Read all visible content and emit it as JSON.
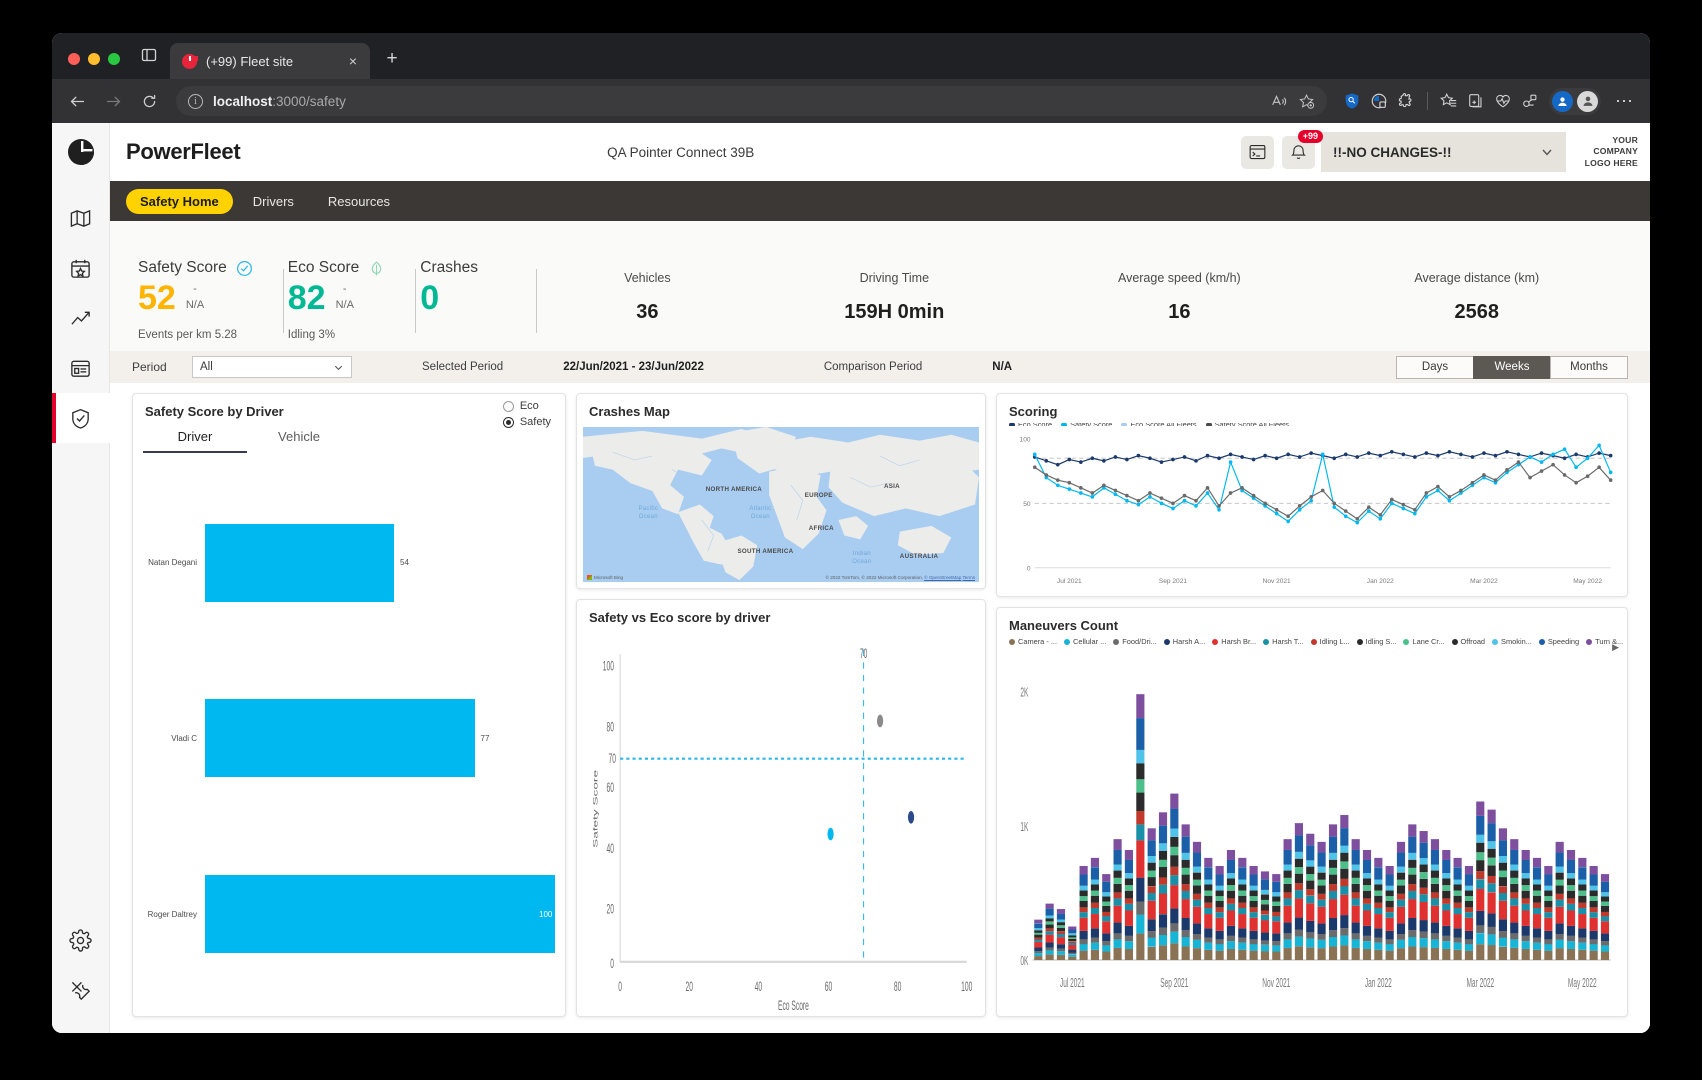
{
  "browser": {
    "tab_title": "(+99) Fleet site",
    "tab_close": "×",
    "new_tab": "+",
    "url_bold": "localhost",
    "url_rest": ":3000/safety"
  },
  "header": {
    "brand": "PowerFleet",
    "site_name": "QA Pointer Connect 39B",
    "notifications_badge": "+99",
    "fleet_selected": "!!-NO CHANGES-!!",
    "company_logo": "YOUR COMPANY LOGO HERE"
  },
  "nav": {
    "tabs": [
      {
        "label": "Safety Home",
        "active": true
      },
      {
        "label": "Drivers",
        "active": false
      },
      {
        "label": "Resources",
        "active": false
      }
    ]
  },
  "kpis": {
    "safety": {
      "title": "Safety Score",
      "value": "52",
      "delta": "-",
      "delta_sub": "N/A",
      "sub": "Events per km 5.28"
    },
    "eco": {
      "title": "Eco Score",
      "value": "82",
      "delta": "-",
      "delta_sub": "N/A",
      "sub": "Idling 3%"
    },
    "crashes": {
      "title": "Crashes",
      "value": "0"
    },
    "stats": [
      {
        "label": "Vehicles",
        "value": "36"
      },
      {
        "label": "Driving Time",
        "value": "159H 0min"
      },
      {
        "label": "Average speed (km/h)",
        "value": "16"
      },
      {
        "label": "Average distance (km)",
        "value": "2568"
      }
    ]
  },
  "period_bar": {
    "period_label": "Period",
    "period_value": "All",
    "selected_period_label": "Selected Period",
    "selected_period_value": "22/Jun/2021 - 23/Jun/2022",
    "comparison_label": "Comparison Period",
    "comparison_value": "N/A",
    "granularity": [
      {
        "label": "Days",
        "active": false
      },
      {
        "label": "Weeks",
        "active": true
      },
      {
        "label": "Months",
        "active": false
      }
    ]
  },
  "safety_by_driver": {
    "title": "Safety Score by Driver",
    "tabs": [
      {
        "label": "Driver",
        "active": true
      },
      {
        "label": "Vehicle",
        "active": false
      }
    ],
    "radios": [
      {
        "label": "Eco",
        "selected": false
      },
      {
        "label": "Safety",
        "selected": true
      }
    ],
    "chart_data": {
      "type": "bar",
      "orientation": "horizontal",
      "title": "Safety Score by Driver",
      "categories": [
        "Natan Degani",
        "Vladi C",
        "Roger Daltrey"
      ],
      "values": [
        54,
        77,
        100
      ],
      "xlim": [
        0,
        100
      ],
      "series_color": "#00b8f0"
    }
  },
  "crashes_map": {
    "title": "Crashes Map",
    "labels": [
      "NORTH AMERICA",
      "EUROPE",
      "ASIA",
      "AFRICA",
      "SOUTH AMERICA",
      "AUSTRALIA"
    ],
    "ocean_labels": [
      "Pacific Ocean",
      "Atlantic Ocean",
      "Indian Ocean"
    ],
    "credit": "© 2022 TomTom, © 2022 Microsoft Corporation,",
    "credit_link": "© OpenStreetMap",
    "credit_terms": "Terms",
    "provider": "Microsoft Bing"
  },
  "safety_vs_eco": {
    "title": "Safety vs Eco score by driver",
    "chart_data": {
      "type": "scatter",
      "title": "Safety vs Eco score by driver",
      "xlabel": "Eco Score",
      "ylabel": "Safety Score",
      "xlim": [
        0,
        100
      ],
      "ylim": [
        0,
        100
      ],
      "xticks": [
        0,
        20,
        40,
        60,
        80,
        100
      ],
      "yticks": [
        0,
        20,
        40,
        60,
        80,
        100
      ],
      "reference_lines": {
        "x": 70,
        "y": 70
      },
      "points": [
        {
          "x": 62,
          "y": 52,
          "color": "#00b8f0"
        },
        {
          "x": 73,
          "y": 78,
          "color": "#8a8a8a"
        },
        {
          "x": 82,
          "y": 56,
          "color": "#2b4a8b"
        }
      ]
    }
  },
  "scoring": {
    "title": "Scoring",
    "chart_data": {
      "type": "line",
      "title": "Scoring",
      "ylim": [
        0,
        100
      ],
      "yticks": [
        0,
        50,
        100
      ],
      "xticks": [
        "Jul 2021",
        "Sep 2021",
        "Nov 2021",
        "Jan 2022",
        "Mar 2022",
        "May 2022"
      ],
      "legend": [
        {
          "name": "Eco Score",
          "color": "#1b3a6b"
        },
        {
          "name": "Safety Score",
          "color": "#00b8f0"
        },
        {
          "name": "Eco Score All Fleets",
          "color": "#a8cdf0"
        },
        {
          "name": "Safety Score All Fleets",
          "color": "#4a4a4a"
        }
      ],
      "series": [
        {
          "name": "Eco Score",
          "color": "#1b3a6b",
          "values": [
            86,
            83,
            80,
            84,
            82,
            85,
            83,
            86,
            84,
            87,
            85,
            82,
            84,
            86,
            83,
            87,
            85,
            88,
            86,
            84,
            87,
            85,
            88,
            86,
            89,
            87,
            85,
            88,
            86,
            89,
            87,
            90,
            88,
            86,
            89,
            87,
            90,
            88,
            86,
            89,
            87,
            90,
            88,
            86,
            89,
            87,
            85,
            88,
            86,
            89,
            87
          ]
        },
        {
          "name": "Safety Score",
          "color": "#00b8f0",
          "values": [
            88,
            70,
            64,
            61,
            58,
            55,
            62,
            57,
            52,
            49,
            55,
            50,
            46,
            52,
            48,
            58,
            45,
            82,
            60,
            54,
            48,
            42,
            36,
            45,
            52,
            88,
            47,
            40,
            35,
            44,
            38,
            50,
            46,
            42,
            55,
            60,
            52,
            58,
            64,
            70,
            66,
            74,
            80,
            86,
            82,
            88,
            92,
            78,
            85,
            95,
            74
          ]
        },
        {
          "name": "Safety Score All Fleets",
          "color": "#6a6a6a",
          "values": [
            78,
            72,
            68,
            66,
            62,
            58,
            64,
            60,
            56,
            52,
            58,
            54,
            50,
            56,
            52,
            62,
            48,
            58,
            62,
            56,
            50,
            45,
            40,
            48,
            55,
            60,
            50,
            44,
            38,
            47,
            41,
            53,
            49,
            45,
            58,
            63,
            55,
            60,
            66,
            72,
            68,
            76,
            82,
            70,
            75,
            80,
            72,
            66,
            71,
            78,
            68
          ]
        }
      ],
      "reference_lines": [
        50,
        85
      ]
    }
  },
  "maneuvers": {
    "title": "Maneuvers Count",
    "legend_arrow": "▶",
    "chart_data": {
      "type": "bar",
      "stacked": true,
      "title": "Maneuvers Count",
      "yticks": [
        "0K",
        "1K",
        "2K"
      ],
      "ylim": [
        0,
        2000
      ],
      "xticks": [
        "Jul 2021",
        "Sep 2021",
        "Nov 2021",
        "Jan 2022",
        "Mar 2022",
        "May 2022"
      ],
      "legend": [
        {
          "name": "Camera - ...",
          "color": "#8a7355"
        },
        {
          "name": "Cellular ...",
          "color": "#18b4d6"
        },
        {
          "name": "Food/Dri...",
          "color": "#6b6b6b"
        },
        {
          "name": "Harsh A...",
          "color": "#1b3a6b"
        },
        {
          "name": "Harsh Br...",
          "color": "#e03131"
        },
        {
          "name": "Harsh T...",
          "color": "#1a8fa8"
        },
        {
          "name": "Idling L...",
          "color": "#c0392b"
        },
        {
          "name": "Idling S...",
          "color": "#2b2b2b"
        },
        {
          "name": "Lane Cr...",
          "color": "#4cbf8b"
        },
        {
          "name": "Offroad",
          "color": "#2b2b2b"
        },
        {
          "name": "Smokin...",
          "color": "#4fc3e8"
        },
        {
          "name": "Speeding",
          "color": "#1b5fa8"
        },
        {
          "name": "Turn &...",
          "color": "#7d4f9e"
        }
      ],
      "totals": [
        300,
        420,
        380,
        250,
        700,
        760,
        640,
        900,
        820,
        1980,
        980,
        1100,
        1240,
        1010,
        880,
        760,
        700,
        820,
        760,
        700,
        660,
        640,
        900,
        1020,
        940,
        880,
        1010,
        1080,
        900,
        820,
        760,
        700,
        880,
        1010,
        960,
        900,
        820,
        760,
        700,
        1180,
        1120,
        980,
        900,
        820,
        760,
        700,
        880,
        820,
        760,
        700,
        640
      ]
    }
  },
  "rail": {
    "items": [
      "map-icon",
      "calendar-star-icon",
      "chart-line-icon",
      "report-icon",
      "shield-check-icon",
      "settings-icon",
      "tools-icon"
    ]
  }
}
